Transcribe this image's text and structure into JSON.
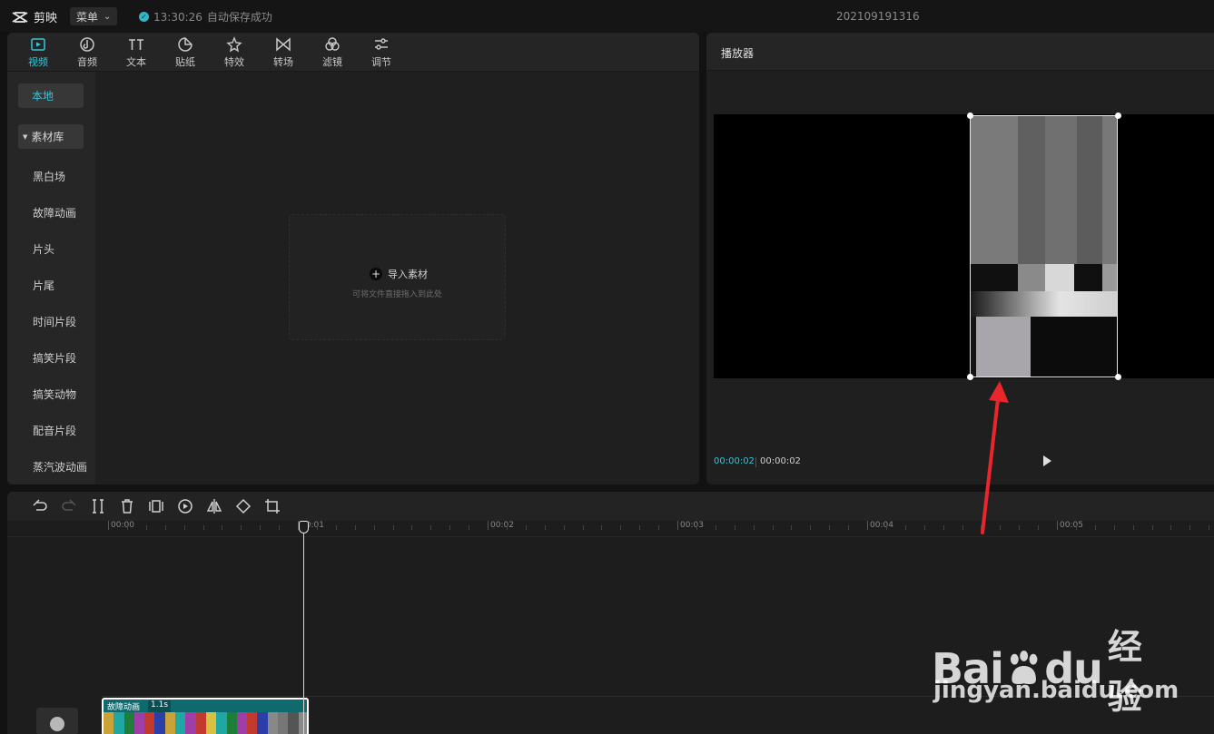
{
  "app": {
    "name": "剪映",
    "menu_label": "菜单",
    "save_time": "13:30:26",
    "save_status": "自动保存成功",
    "project_name": "202109191316"
  },
  "toolbar": {
    "tabs": [
      {
        "label": "视频",
        "icon": "video-icon",
        "active": true
      },
      {
        "label": "音频",
        "icon": "audio-icon",
        "active": false
      },
      {
        "label": "文本",
        "icon": "text-icon",
        "active": false
      },
      {
        "label": "贴纸",
        "icon": "sticker-icon",
        "active": false
      },
      {
        "label": "特效",
        "icon": "effects-icon",
        "active": false
      },
      {
        "label": "转场",
        "icon": "transition-icon",
        "active": false
      },
      {
        "label": "滤镜",
        "icon": "filter-icon",
        "active": false
      },
      {
        "label": "调节",
        "icon": "adjust-icon",
        "active": false
      }
    ]
  },
  "sidebar": {
    "local_label": "本地",
    "library_label": "素材库",
    "items": [
      "黑白场",
      "故障动画",
      "片头",
      "片尾",
      "时间片段",
      "搞笑片段",
      "搞笑动物",
      "配音片段",
      "蒸汽波动画"
    ]
  },
  "import": {
    "title": "导入素材",
    "hint": "可将文件直接拖入到此处"
  },
  "player": {
    "title": "播放器",
    "current_time": "00:00:02",
    "total_time": "00:00:02"
  },
  "timeline": {
    "tools": [
      "undo-icon",
      "redo-icon",
      "split-icon",
      "delete-icon",
      "freeze-icon",
      "reverse-icon",
      "mirror-icon",
      "rotate-icon",
      "crop-icon"
    ],
    "ruler_labels": [
      "00:00",
      "00:01",
      "00:02",
      "00:03",
      "00:04",
      "00:05"
    ],
    "clip": {
      "name": "故障动画",
      "duration": "1.1s"
    }
  },
  "watermark": {
    "brand": "Bai",
    "brand_suffix": "du",
    "brand_cn": "经验",
    "url": "jingyan.baidu.com"
  },
  "colors": {
    "accent": "#35c6d8",
    "panel": "#1f1f1f",
    "clip": "#0f6a6e",
    "arrow": "#e8262b"
  }
}
